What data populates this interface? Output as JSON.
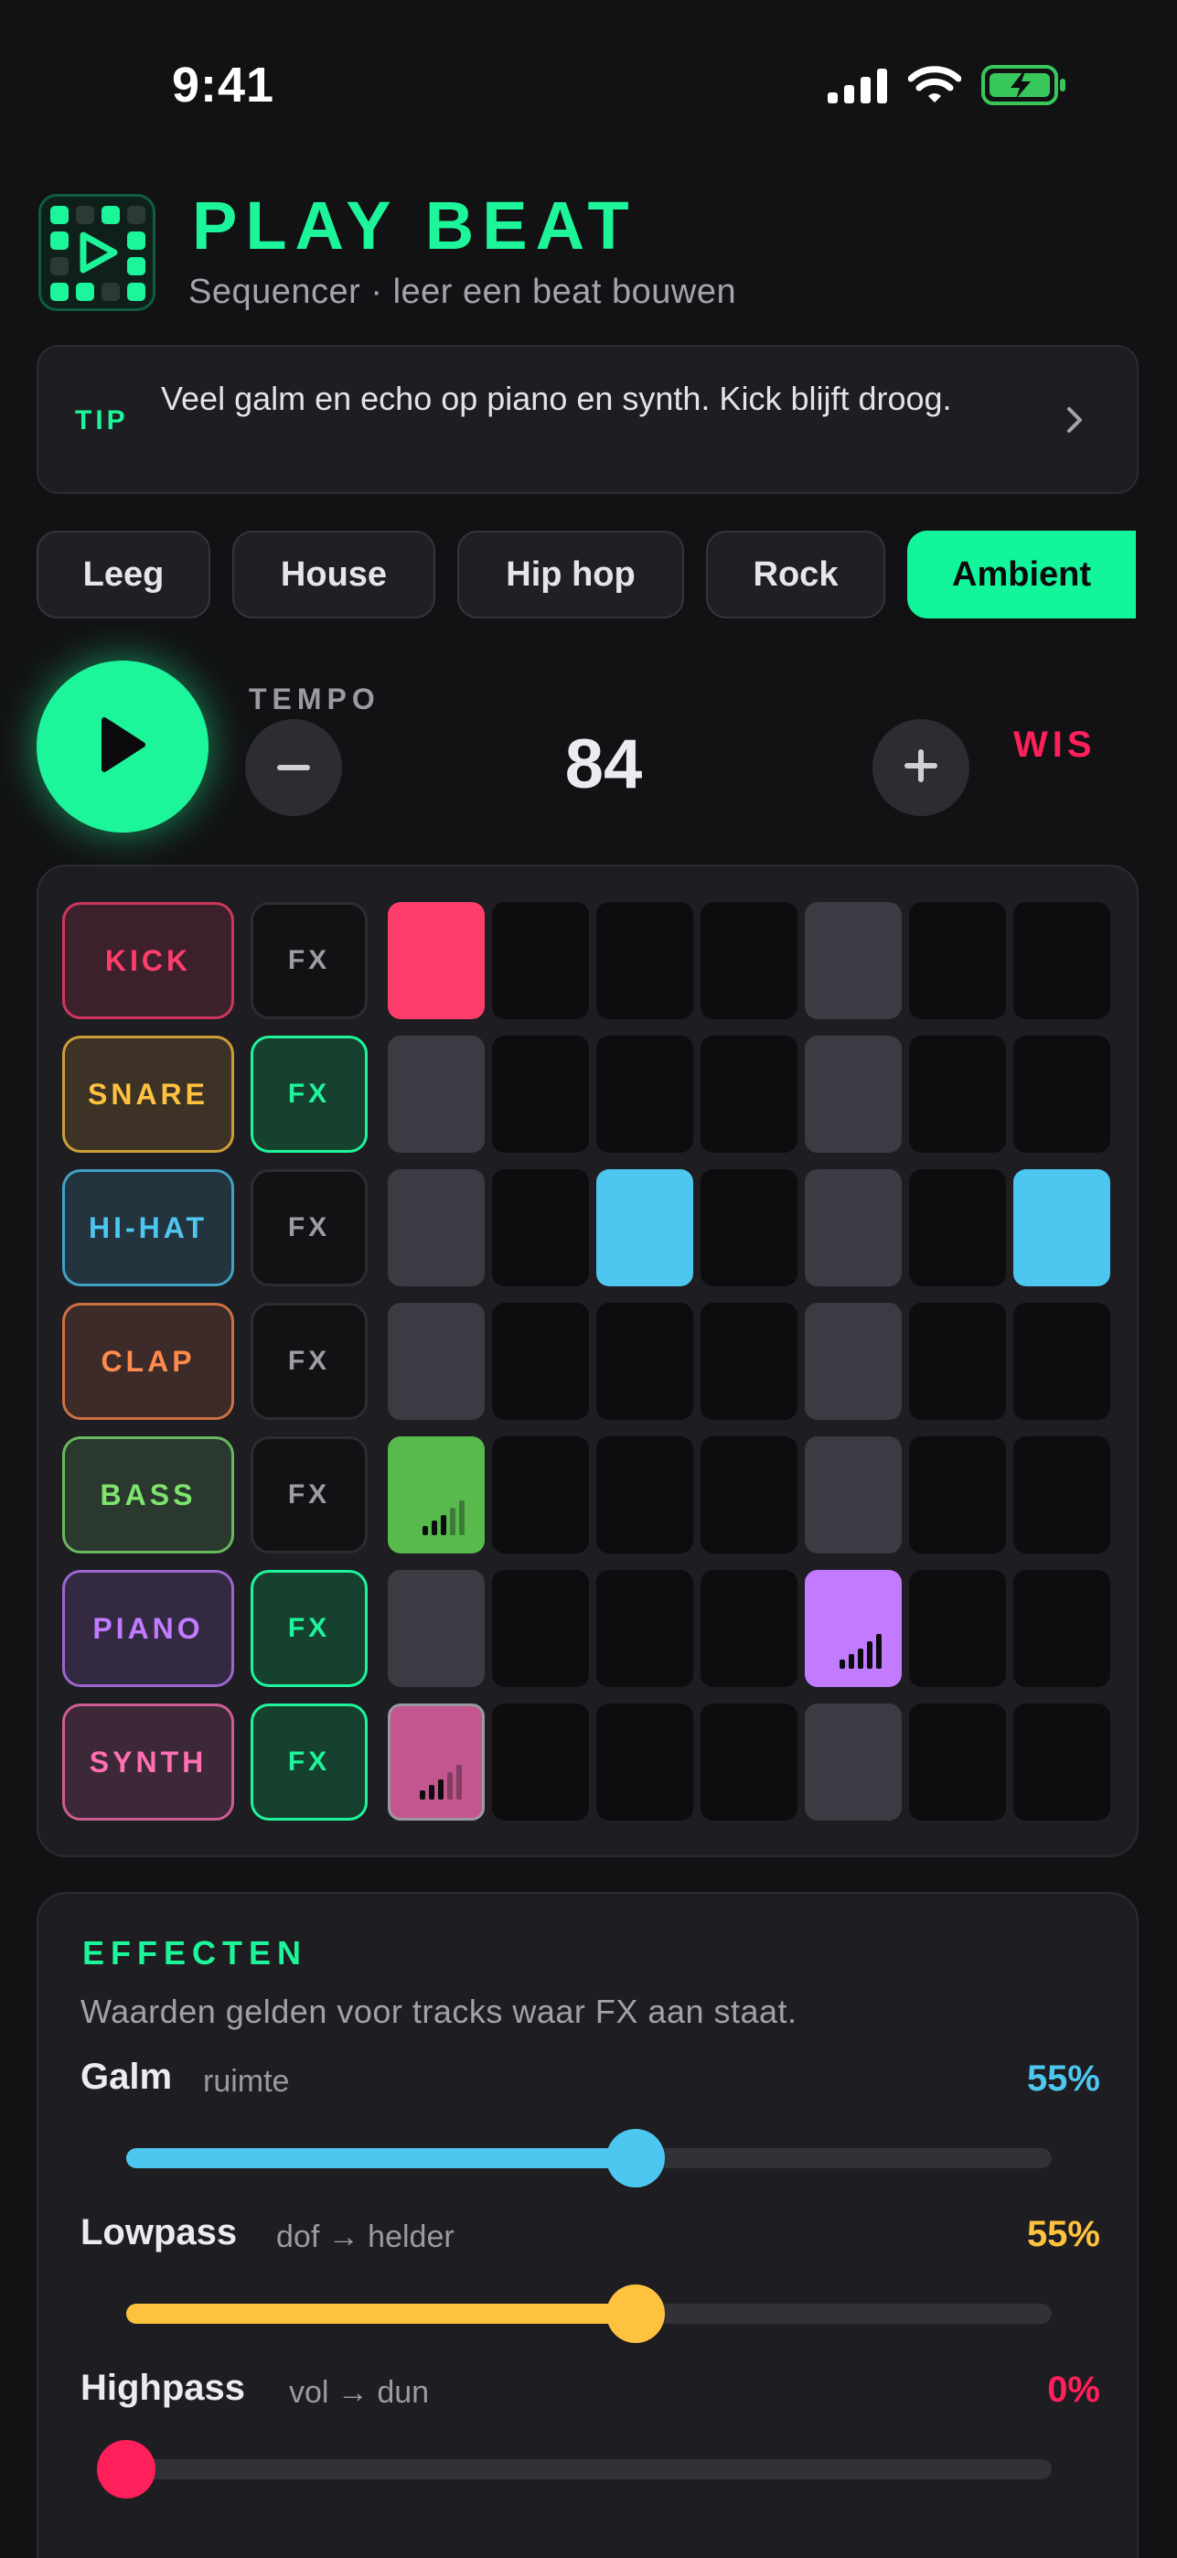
{
  "status": {
    "time": "9:41"
  },
  "header": {
    "title": "PLAY BEAT",
    "subtitle": "Sequencer · leer een beat bouwen"
  },
  "tip": {
    "label": "TIP",
    "text": "Veel galm en echo op piano en synth. Kick blijft droog."
  },
  "presets": [
    {
      "label": "Leeg",
      "active": false
    },
    {
      "label": "House",
      "active": false
    },
    {
      "label": "Hip hop",
      "active": false
    },
    {
      "label": "Rock",
      "active": false
    },
    {
      "label": "Ambient",
      "active": true
    }
  ],
  "transport": {
    "tempo_label": "TEMPO",
    "tempo": "84",
    "clear_label": "WIS"
  },
  "colors": {
    "accent": "#1df59a",
    "danger": "#ff1f5a"
  },
  "fx_label": "FX",
  "tracks": [
    {
      "name": "KICK",
      "color": "#ff3d6c",
      "fx": false,
      "steps": [
        1,
        0,
        0,
        0,
        0,
        0,
        0
      ],
      "velocity": [
        0,
        0,
        0,
        0,
        0,
        0,
        0
      ]
    },
    {
      "name": "SNARE",
      "color": "#ffc23f",
      "fx": true,
      "steps": [
        0,
        0,
        0,
        0,
        0,
        0,
        0
      ],
      "velocity": [
        0,
        0,
        0,
        0,
        0,
        0,
        0
      ]
    },
    {
      "name": "HI-HAT",
      "color": "#4ec7f0",
      "fx": false,
      "steps": [
        0,
        0,
        1,
        0,
        0,
        0,
        1
      ],
      "velocity": [
        0,
        0,
        0,
        0,
        0,
        0,
        0
      ]
    },
    {
      "name": "CLAP",
      "color": "#ff8a4c",
      "fx": false,
      "steps": [
        0,
        0,
        0,
        0,
        0,
        0,
        0
      ],
      "velocity": [
        0,
        0,
        0,
        0,
        0,
        0,
        0
      ]
    },
    {
      "name": "BASS",
      "color": "#7ee36f",
      "fx": false,
      "steps": [
        1,
        0,
        0,
        0,
        0,
        0,
        0
      ],
      "velocity": [
        0.5,
        0,
        0,
        0,
        0,
        0,
        0
      ]
    },
    {
      "name": "PIANO",
      "color": "#c27bff",
      "fx": true,
      "steps": [
        0,
        0,
        0,
        0,
        1,
        0,
        0
      ],
      "velocity": [
        0,
        0,
        0,
        0,
        1,
        0,
        0
      ]
    },
    {
      "name": "SYNTH",
      "color": "#ff6fb3",
      "fx": true,
      "steps": [
        1,
        0,
        0,
        0,
        0,
        0,
        0
      ],
      "velocity": [
        0.5,
        0,
        0,
        0,
        0,
        0,
        0
      ]
    }
  ],
  "step_fill_colors": {
    "BASS": "#58b94c",
    "SYNTH": "#c4568f"
  },
  "beat_columns": [
    0,
    4
  ],
  "effects": {
    "title": "EFFECTEN",
    "description": "Waarden gelden voor tracks waar FX aan staat.",
    "items": [
      {
        "name": "Galm",
        "sub": "ruimte",
        "value_label": "55%",
        "value": 0.55,
        "color": "#4ec7f0"
      },
      {
        "name": "Lowpass",
        "sub": "dof → helder",
        "value_label": "55%",
        "value": 0.55,
        "color": "#ffc23f"
      },
      {
        "name": "Highpass",
        "sub": "vol → dun",
        "value_label": "0%",
        "value": 0.0,
        "color": "#ff1f5a"
      }
    ]
  }
}
